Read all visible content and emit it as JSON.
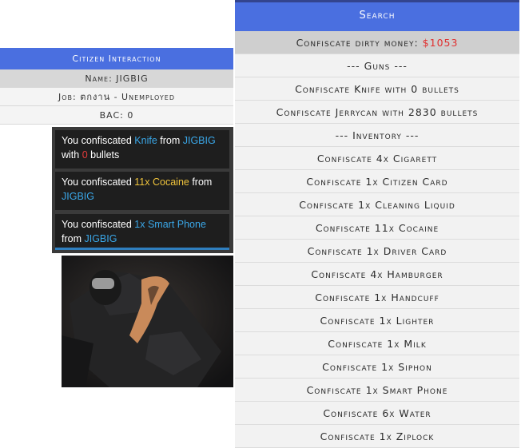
{
  "citizen": {
    "title": "Citizen Interaction",
    "rows": [
      "Name: JIGBIG",
      "Job: ตกงาน - Unemployed",
      "BAC: 0"
    ]
  },
  "notifications": [
    {
      "prefix": "You confiscated ",
      "item": "Knife",
      "mid1": " from ",
      "name": "JIGBIG",
      "mid2": " with ",
      "count": "0",
      "suffix": " bullets"
    },
    {
      "prefix": "You confiscated ",
      "item": "11x Cocaine",
      "mid1": " from ",
      "name": "JIGBIG"
    },
    {
      "prefix": "You confiscated ",
      "item": "1x Smart Phone",
      "mid1": " from ",
      "name": "JIGBIG"
    }
  ],
  "menu": {
    "title": "Search",
    "money_label": "Confiscate dirty money: ",
    "money_value": "$1053",
    "items": [
      "--- Guns ---",
      "Confiscate Knife with 0 bullets",
      "Confiscate Jerrycan with 2830 bullets",
      "--- Inventory ---",
      "Confiscate 4x Cigarett",
      "Confiscate 1x Citizen Card",
      "Confiscate 1x Cleaning Liquid",
      "Confiscate 11x Cocaine",
      "Confiscate 1x Driver Card",
      "Confiscate 4x Hamburger",
      "Confiscate 1x Handcuff",
      "Confiscate 1x Lighter",
      "Confiscate 1x Milk",
      "Confiscate 1x Siphon",
      "Confiscate 1x Smart Phone",
      "Confiscate 6x Water",
      "Confiscate 1x Ziplock"
    ]
  },
  "colors": {
    "accent": "#4a6fe0",
    "money": "#e03030",
    "highlight_blue": "#3aa7e8"
  }
}
